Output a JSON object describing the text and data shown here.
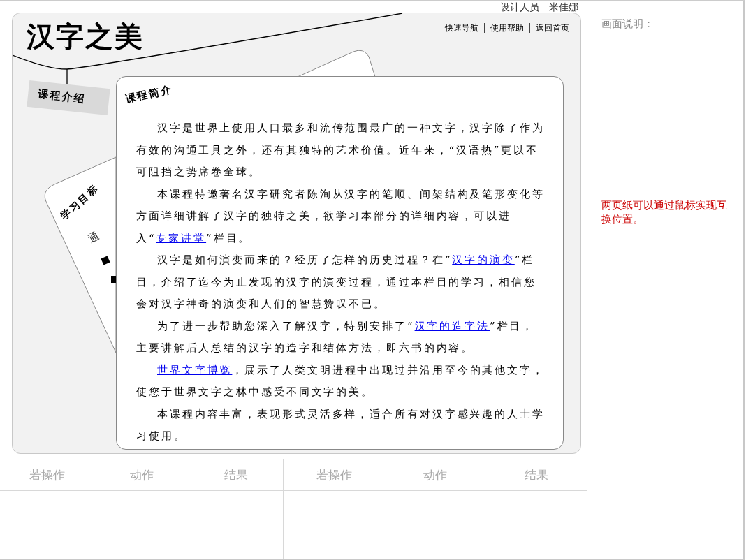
{
  "designer": "设计人员　米佳娜",
  "header": {
    "title": "汉字之美",
    "nav": [
      "快速导航",
      "使用帮助",
      "返回首页"
    ]
  },
  "side_tab": "课程介绍",
  "back_page": {
    "title": "学习目标",
    "text": "通"
  },
  "front_page": {
    "title": "课程简介",
    "paragraphs": [
      {
        "segments": [
          {
            "kind": "text",
            "text": "汉字是世界上使用人口最多和流传范围最广的一种文字，汉字除了作为有效的沟通工具之外，还有其独特的艺术价值。近年来，“汉语热”更以不可阻挡之势席卷全球。"
          }
        ]
      },
      {
        "segments": [
          {
            "kind": "text",
            "text": "本课程特邀著名汉字研究者陈洵从汉字的笔顺、间架结构及笔形变化等方面详细讲解了汉字的独特之美，欲学习本部分的详细内容，可以进入“"
          },
          {
            "kind": "link",
            "text": "专家讲堂"
          },
          {
            "kind": "text",
            "text": "”栏目。"
          }
        ]
      },
      {
        "segments": [
          {
            "kind": "text",
            "text": "汉字是如何演变而来的？经历了怎样的历史过程？在“"
          },
          {
            "kind": "link",
            "text": "汉字的演变"
          },
          {
            "kind": "text",
            "text": "”栏目，介绍了迄今为止发现的汉字的演变过程，通过本栏目的学习，相信您会对汉字神奇的演变和人们的智慧赞叹不已。"
          }
        ]
      },
      {
        "segments": [
          {
            "kind": "text",
            "text": "为了进一步帮助您深入了解汉字，特别安排了“"
          },
          {
            "kind": "link",
            "text": "汉字的造字法"
          },
          {
            "kind": "text",
            "text": "”栏目，主要讲解后人总结的汉字的造字和结体方法，即六书的内容。"
          }
        ]
      },
      {
        "segments": [
          {
            "kind": "link",
            "text": "世界文字博览"
          },
          {
            "kind": "text",
            "text": "，展示了人类文明进程中出现过并沿用至今的其他文字，使您于世界文字之林中感受不同文字的美。"
          }
        ]
      },
      {
        "segments": [
          {
            "kind": "text",
            "text": "本课程内容丰富，表现形式灵活多样，适合所有对汉字感兴趣的人士学习使用。"
          }
        ]
      }
    ]
  },
  "notes": {
    "heading": "画面说明：",
    "text": "两页纸可以通过鼠标实现互换位置。"
  },
  "tables": [
    {
      "columns": [
        "若操作",
        "动作",
        "结果"
      ]
    },
    {
      "columns": [
        "若操作",
        "动作",
        "结果"
      ]
    }
  ]
}
